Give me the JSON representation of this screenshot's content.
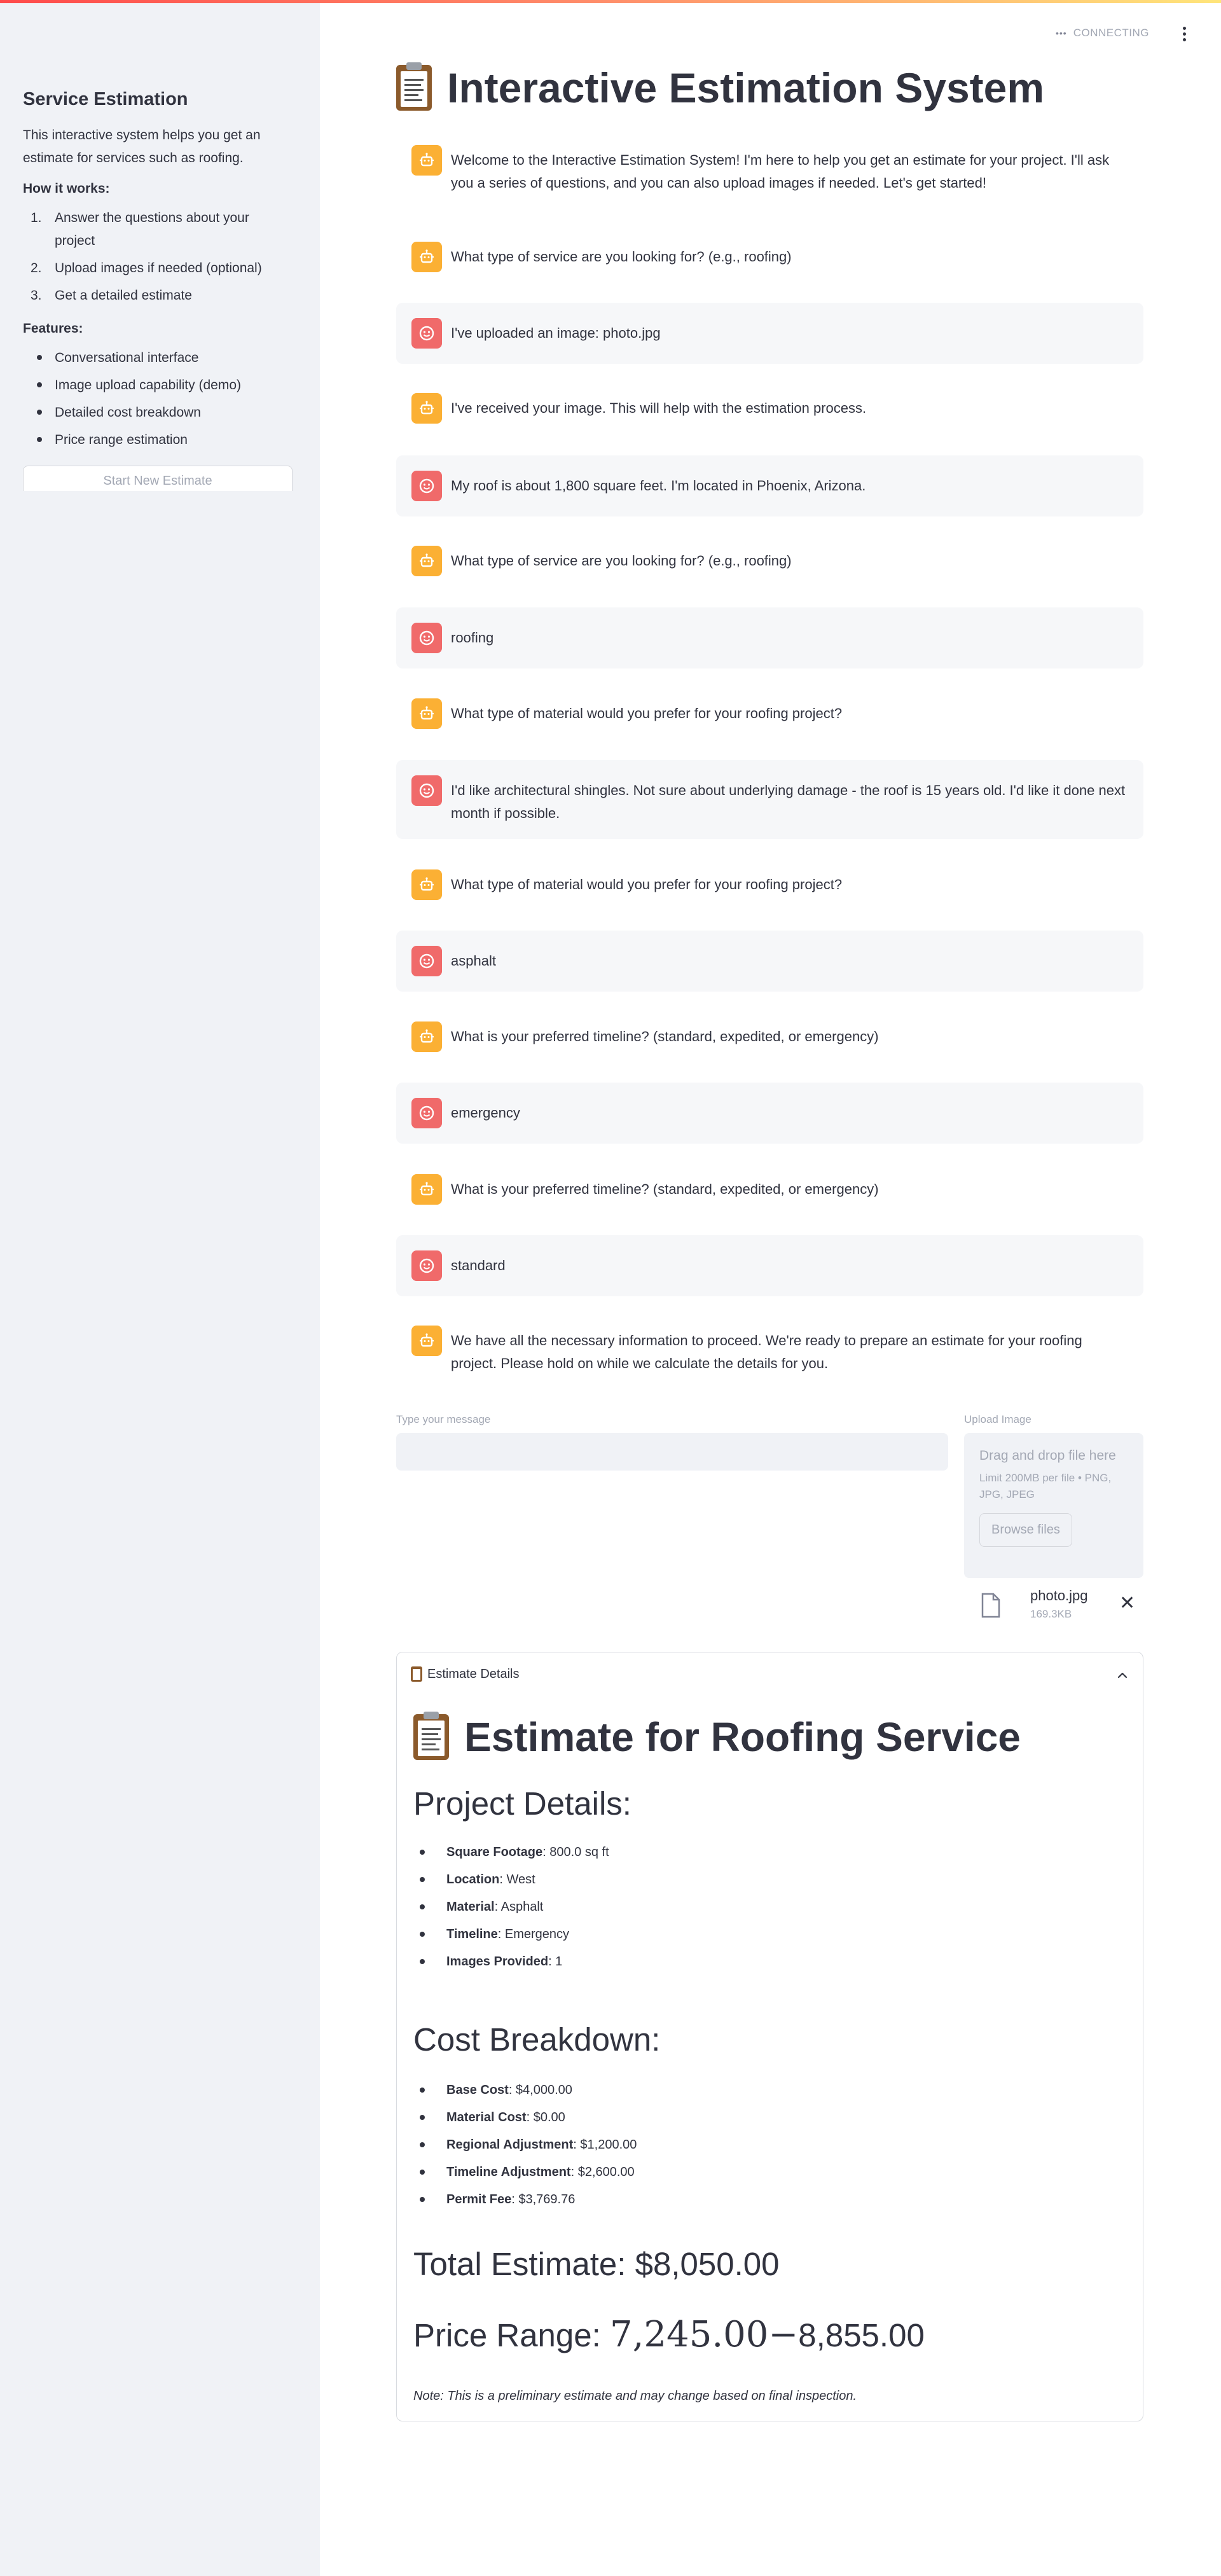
{
  "sidebar": {
    "title": "Service Estimation",
    "intro": "This interactive system helps you get an estimate for services such as roofing.",
    "how_heading": "How it works:",
    "how_steps": [
      "Answer the questions about your project",
      "Upload images if needed (optional)",
      "Get a detailed estimate"
    ],
    "features_heading": "Features:",
    "features": [
      "Conversational interface",
      "Image upload capability (demo)",
      "Detailed cost breakdown",
      "Price range estimation"
    ],
    "new_button": "Start New Estimate"
  },
  "header": {
    "status": "CONNECTING"
  },
  "main": {
    "title": "Interactive Estimation System",
    "messages": [
      {
        "role": "bot",
        "text": "Welcome to the Interactive Estimation System! I'm here to help you get an estimate for your project. I'll ask you a series of questions, and you can also upload images if needed. Let's get started!"
      },
      {
        "role": "bot",
        "text": "What type of service are you looking for? (e.g., roofing)"
      },
      {
        "role": "user",
        "text": "I've uploaded an image: photo.jpg"
      },
      {
        "role": "bot",
        "text": "I've received your image. This will help with the estimation process."
      },
      {
        "role": "user",
        "text": "My roof is about 1,800 square feet. I'm located in Phoenix, Arizona."
      },
      {
        "role": "bot",
        "text": "What type of service are you looking for? (e.g., roofing)"
      },
      {
        "role": "user",
        "text": "roofing"
      },
      {
        "role": "bot",
        "text": "What type of material would you prefer for your roofing project?"
      },
      {
        "role": "user",
        "text": "I'd like architectural shingles. Not sure about underlying damage - the roof is 15 years old. I'd like it done next month if possible."
      },
      {
        "role": "bot",
        "text": "What type of material would you prefer for your roofing project?"
      },
      {
        "role": "user",
        "text": "asphalt"
      },
      {
        "role": "bot",
        "text": "What is your preferred timeline? (standard, expedited, or emergency)"
      },
      {
        "role": "user",
        "text": "emergency"
      },
      {
        "role": "bot",
        "text": "What is your preferred timeline? (standard, expedited, or emergency)"
      },
      {
        "role": "user",
        "text": "standard"
      },
      {
        "role": "bot",
        "text": "We have all the necessary information to proceed. We're ready to prepare an estimate for your roofing project. Please hold on while we calculate the details for you."
      }
    ],
    "input_label": "Type your message",
    "input_value": "",
    "upload": {
      "label": "Upload Image",
      "drop_text": "Drag and drop file here",
      "limit_text": "Limit 200MB per file • PNG, JPG, JPEG",
      "browse_label": "Browse files",
      "file_name": "photo.jpg",
      "file_size": "169.3KB",
      "remove_symbol": "✕"
    },
    "estimate": {
      "expander_label": "Estimate Details",
      "title": "Estimate for Roofing Service",
      "project_heading": "Project Details:",
      "project_details": [
        {
          "label": "Square Footage",
          "value": ": 800.0 sq ft"
        },
        {
          "label": "Location",
          "value": ": West"
        },
        {
          "label": "Material",
          "value": ": Asphalt"
        },
        {
          "label": "Timeline",
          "value": ": Emergency"
        },
        {
          "label": "Images Provided",
          "value": ": 1"
        }
      ],
      "cost_heading": "Cost Breakdown:",
      "costs": [
        {
          "label": "Base Cost",
          "value": ": $4,000.00"
        },
        {
          "label": "Material Cost",
          "value": ": $0.00"
        },
        {
          "label": "Regional Adjustment",
          "value": ": $1,200.00"
        },
        {
          "label": "Timeline Adjustment",
          "value": ": $2,600.00"
        },
        {
          "label": "Permit Fee",
          "value": ": $3,769.76"
        }
      ],
      "total": "Total Estimate: $8,050.00",
      "range_prefix": "Price Range: ",
      "range_math": "7,245.00−",
      "range_end": "8,855.00",
      "note": "Note: This is a preliminary estimate and may change based on final inspection."
    }
  }
}
